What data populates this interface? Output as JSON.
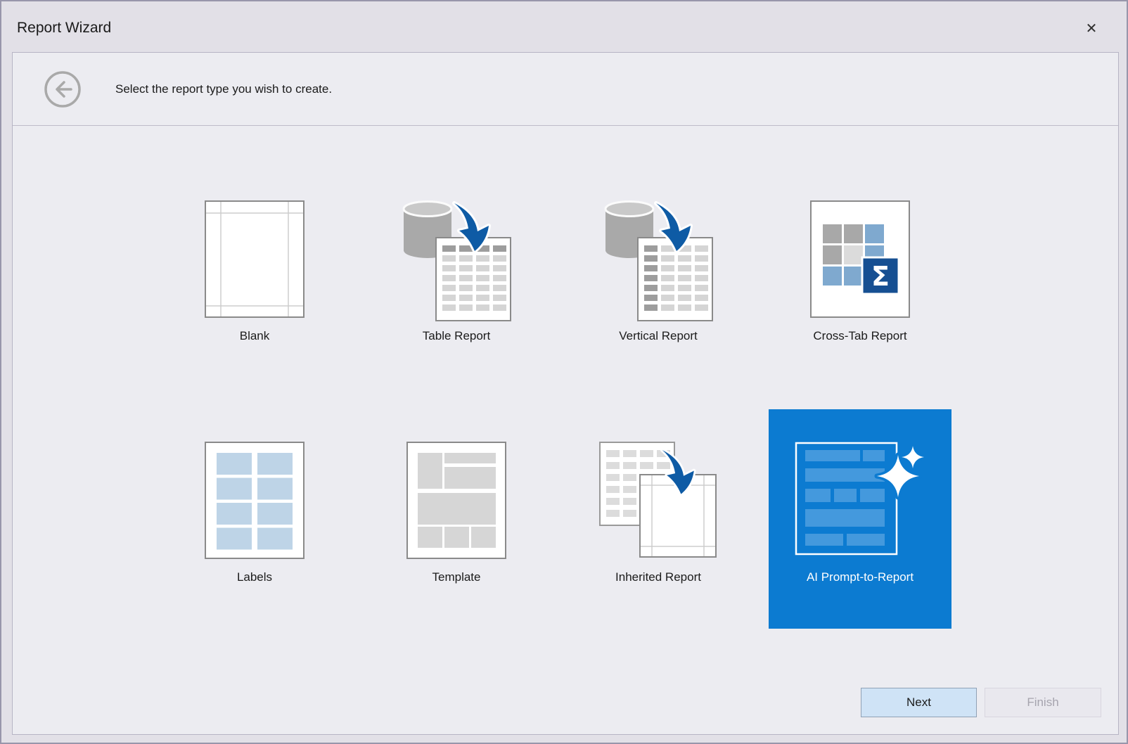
{
  "window": {
    "title": "Report Wizard",
    "close_glyph": "✕"
  },
  "header": {
    "instruction": "Select the report type you wish to create.",
    "back_icon": "back-arrow-circle"
  },
  "tiles": [
    {
      "id": "blank",
      "label": "Blank",
      "selected": false
    },
    {
      "id": "table-report",
      "label": "Table Report",
      "selected": false
    },
    {
      "id": "vertical-report",
      "label": "Vertical Report",
      "selected": false
    },
    {
      "id": "cross-tab-report",
      "label": "Cross-Tab Report",
      "selected": false
    },
    {
      "id": "labels",
      "label": "Labels",
      "selected": false
    },
    {
      "id": "template",
      "label": "Template",
      "selected": false
    },
    {
      "id": "inherited-report",
      "label": "Inherited Report",
      "selected": false
    },
    {
      "id": "ai-prompt-to-report",
      "label": "AI Prompt-to-Report",
      "selected": true
    }
  ],
  "footer": {
    "next_label": "Next",
    "finish_label": "Finish",
    "finish_enabled": false
  },
  "colors": {
    "window_bg": "#e2e0e7",
    "window_border": "#9896ab",
    "panel_bg": "#ececf1",
    "panel_border": "#b6b4c4",
    "text": "#1b1b1b",
    "selected_tile_bg": "#0c7bd1",
    "ai_inner_blue": "#4499dd",
    "arrow_blue": "#0e5ba5",
    "sigma_navy": "#164f92",
    "crosstab_blue": "#7fa9cf",
    "labels_blue": "#bed4e7",
    "next_button_bg": "#cfe3f6"
  }
}
